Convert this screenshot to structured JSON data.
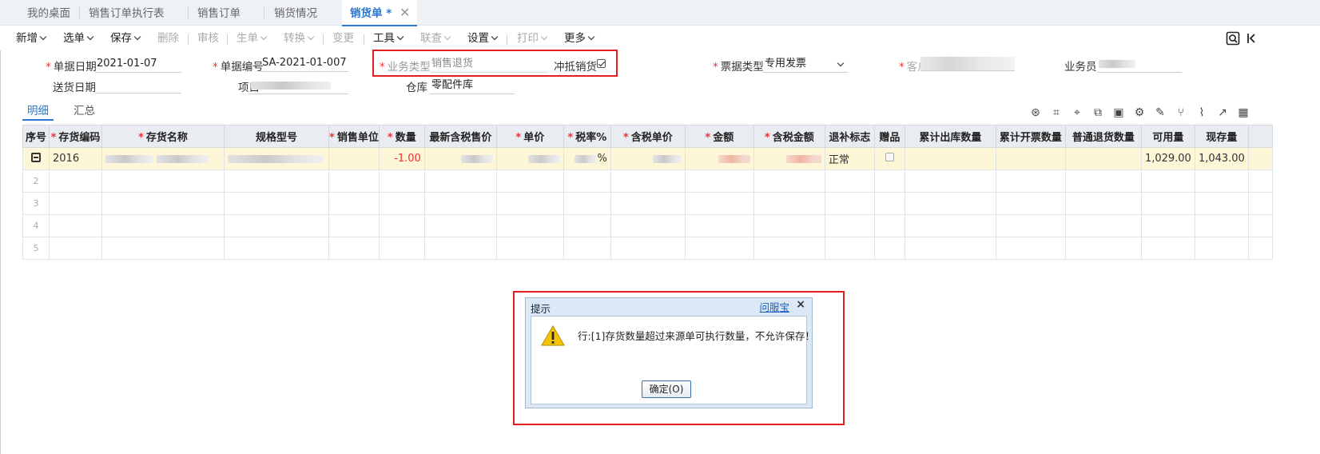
{
  "tabs": [
    {
      "label": "我的桌面"
    },
    {
      "label": "销售订单执行表"
    },
    {
      "label": "销售订单"
    },
    {
      "label": "销货情况"
    },
    {
      "label": "销货单 *",
      "active": true
    }
  ],
  "toolbar": {
    "new": "新增",
    "select": "选单",
    "save": "保存",
    "delete": "删除",
    "audit": "审核",
    "generate": "生单",
    "convert": "转换",
    "change": "变更",
    "tools": "工具",
    "query": "联查",
    "settings": "设置",
    "print": "打印",
    "more": "更多"
  },
  "form": {
    "doc_date_label": "单据日期",
    "doc_date": "2021-01-07",
    "doc_no_label": "单据编号",
    "doc_no": "SA-2021-01-007",
    "biz_type_label": "业务类型",
    "biz_type": "销售退货",
    "offset_label": "冲抵销货",
    "invoice_type_label": "票据类型",
    "invoice_type": "专用发票",
    "customer_label": "客户",
    "salesman_label": "业务员",
    "delivery_date_label": "送货日期",
    "project_label": "项目",
    "warehouse_label": "仓库",
    "warehouse": "零配件库"
  },
  "subtabs": {
    "detail": "明细",
    "summary": "汇总"
  },
  "grid": {
    "columns": [
      "序号",
      "存货编码",
      "存货名称",
      "规格型号",
      "销售单位",
      "数量",
      "最新含税售价",
      "单价",
      "税率%",
      "含税单价",
      "金额",
      "含税金额",
      "退补标志",
      "赠品",
      "累计出库数量",
      "累计开票数量",
      "普通退货数量",
      "可用量",
      "现存量"
    ],
    "required": [
      "存货编码",
      "存货名称",
      "销售单位",
      "数量",
      "单价",
      "税率%",
      "含税单价",
      "金额",
      "含税金额"
    ],
    "row1": {
      "code": "2016",
      "qty": "-1.00",
      "tax_suffix": "%",
      "flag": "正常",
      "available": "1,029.00",
      "stock": "1,043.00"
    },
    "row_numbers": [
      "2",
      "3",
      "4",
      "5"
    ]
  },
  "dialog": {
    "title": "提示",
    "help": "问服宝",
    "close": "×",
    "message": "行:[1]存货数量超过来源单可执行数量，不允许保存！",
    "ok": "确定(O)"
  },
  "colors": {
    "accent": "#2b78d0",
    "highlight": "#e02020",
    "selected_row": "#fdf7d8"
  }
}
